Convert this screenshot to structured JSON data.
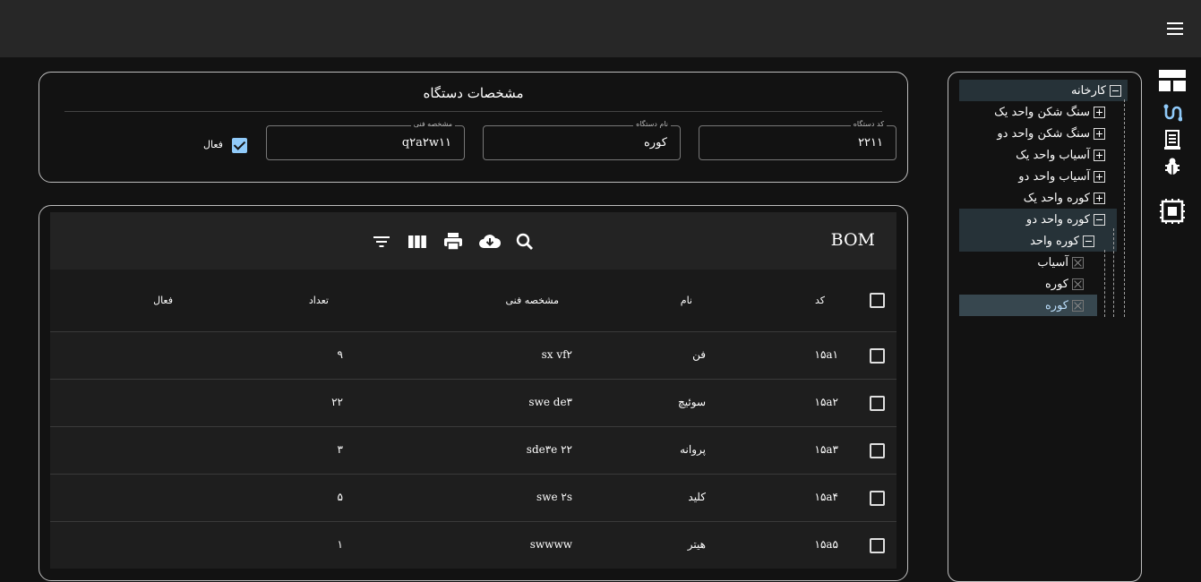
{
  "tree": {
    "items": [
      {
        "label": "کارخانه",
        "state": "minus"
      },
      {
        "label": "سنگ شکن واحد یک",
        "state": "plus"
      },
      {
        "label": "سنگ شکن واحد دو",
        "state": "plus"
      },
      {
        "label": "آسیاب واحد یک",
        "state": "plus"
      },
      {
        "label": "آسیاب واحد دو",
        "state": "plus"
      },
      {
        "label": "کوره واحد یک",
        "state": "plus"
      },
      {
        "label": "کوره واحد دو",
        "state": "minus"
      },
      {
        "label": "کوره واحد",
        "state": "minus"
      },
      {
        "label": "آسیاب",
        "state": "leaf"
      },
      {
        "label": "کوره",
        "state": "leaf"
      },
      {
        "label": "کوره",
        "state": "leaf"
      }
    ]
  },
  "device": {
    "title": "مشخصات دستگاه",
    "code": {
      "label": "کد دستگاه",
      "value": "۲۲۱۱"
    },
    "name": {
      "label": "نام دستگاه",
      "value": "کوره"
    },
    "spec": {
      "label": "مشخصه فنی",
      "value": "q۲a۲w۱۱"
    },
    "active_label": "فعال",
    "active": true
  },
  "bom": {
    "title": "BOM",
    "toolbar_icons": [
      "search-icon",
      "cloud-download-icon",
      "print-icon",
      "view-column-icon",
      "filter-icon"
    ],
    "columns": {
      "code": "کد",
      "name": "نام",
      "spec": "مشخصه فنی",
      "count": "تعداد",
      "active": "فعال"
    },
    "rows": [
      {
        "code": "۱۵a۱",
        "name": "فن",
        "spec": "sx vf۲",
        "count": "۹"
      },
      {
        "code": "۱۵a۲",
        "name": "سوئیچ",
        "spec": "swe de۳",
        "count": "۲۲"
      },
      {
        "code": "۱۵a۳",
        "name": "پروانه",
        "spec": "sde۳e ۲۲",
        "count": "۳"
      },
      {
        "code": "۱۵a۴",
        "name": "کلید",
        "spec": "swe ۲s",
        "count": "۵"
      },
      {
        "code": "۱۵a۵",
        "name": "هیتر",
        "spec": "swwww",
        "count": "۱"
      }
    ]
  },
  "colors": {
    "accent": "#90caf9",
    "appbar": "#272727",
    "background": "#121212"
  }
}
